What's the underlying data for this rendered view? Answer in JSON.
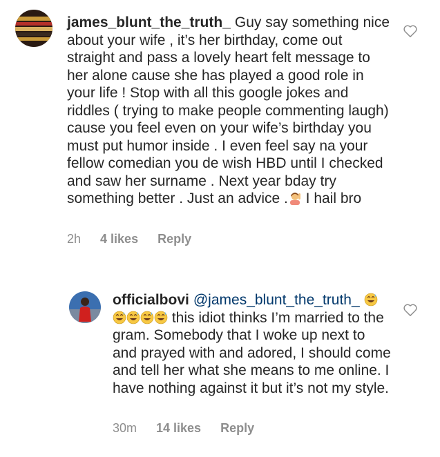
{
  "comments": [
    {
      "username": "james_blunt_the_truth_",
      "text_part1": "Guy say something nice about your wife , it’s her birthday, come out straight and pass a lovely heart felt message to her alone cause she has played a good role in your life ! Stop with all this google jokes and riddles ( trying to make people commenting laugh) cause you feel even on your wife’s birthday you must put humor inside . I even feel say na your fellow comedian you de wish HBD until I checked and saw her surname . Next year bday try something better . Just an advice .",
      "text_part2": " I hail bro",
      "time": "2h",
      "likes": "4 likes",
      "reply_label": "Reply",
      "emoji_icon": "person-raising-hand-emoji"
    },
    {
      "username": "officialbovi",
      "mention": "@james_blunt_the_truth_",
      "text": " this idiot thinks I’m married to the gram. Somebody that I woke up next to and prayed with and adored, I should come and tell her what she means to me online. I have nothing against it but it’s not my style.",
      "time": "30m",
      "likes": "14 likes",
      "reply_label": "Reply",
      "emoji_icon": "grinning-sweat-emoji"
    }
  ],
  "colors": {
    "text": "#262626",
    "meta": "#8e8e8e",
    "mention": "#00376b"
  }
}
